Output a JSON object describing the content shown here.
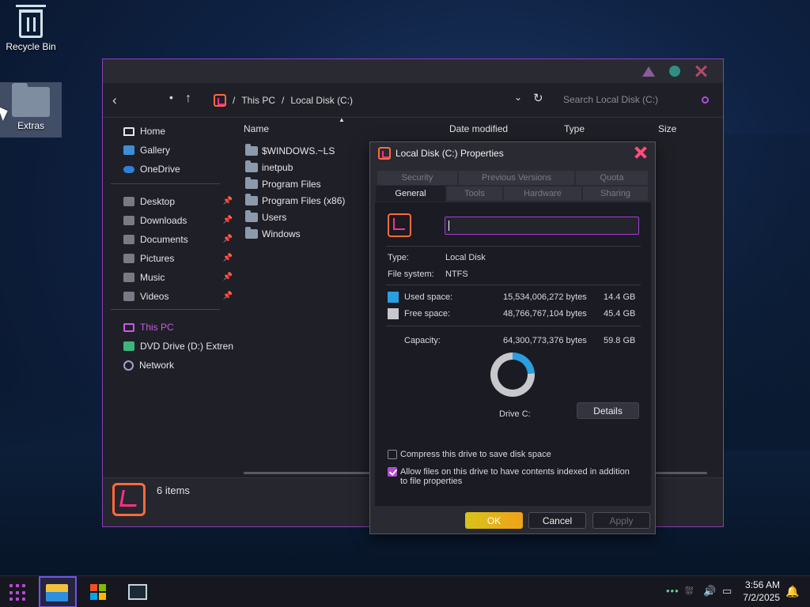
{
  "desktop": {
    "icons": [
      {
        "label": "Recycle Bin"
      },
      {
        "label": "Extras"
      }
    ]
  },
  "explorer": {
    "breadcrumb": [
      "This PC",
      "Local Disk (C:)"
    ],
    "breadcrumb_sep": "/",
    "search_placeholder": "Search Local Disk (C:)",
    "sidebar": {
      "quick": [
        {
          "label": "Home",
          "icon": "home-icon"
        },
        {
          "label": "Gallery",
          "icon": "gallery-icon"
        },
        {
          "label": "OneDrive",
          "icon": "cloud-icon"
        }
      ],
      "pinned": [
        {
          "label": "Desktop"
        },
        {
          "label": "Downloads"
        },
        {
          "label": "Documents"
        },
        {
          "label": "Pictures"
        },
        {
          "label": "Music"
        },
        {
          "label": "Videos"
        }
      ],
      "devices": [
        {
          "label": "This PC"
        },
        {
          "label": "DVD Drive (D:) Extren"
        },
        {
          "label": "Network"
        }
      ]
    },
    "columns": [
      "Name",
      "Date modified",
      "Type",
      "Size"
    ],
    "files": [
      "$WINDOWS.~LS",
      "inetpub",
      "Program Files",
      "Program Files (x86)",
      "Users",
      "Windows"
    ],
    "status": "6 items"
  },
  "dialog": {
    "title": "Local Disk (C:) Properties",
    "tabs_back": [
      "Security",
      "Previous Versions",
      "Quota"
    ],
    "tabs_front": [
      "General",
      "Tools",
      "Hardware",
      "Sharing"
    ],
    "name_value": "",
    "type_label": "Type:",
    "type_value": "Local Disk",
    "fs_label": "File system:",
    "fs_value": "NTFS",
    "used_label": "Used space:",
    "used_bytes": "15,534,006,272 bytes",
    "used_gb": "14.4 GB",
    "free_label": "Free space:",
    "free_bytes": "48,766,767,104 bytes",
    "free_gb": "45.4 GB",
    "cap_label": "Capacity:",
    "cap_bytes": "64,300,773,376 bytes",
    "cap_gb": "59.8 GB",
    "used_fraction": 0.2416,
    "drive_label": "Drive C:",
    "details_label": "Details",
    "compress_label": "Compress this drive to save disk space",
    "index_label": "Allow files on this drive to have contents indexed in addition to file properties",
    "ok_label": "OK",
    "cancel_label": "Cancel",
    "apply_label": "Apply",
    "colors": {
      "used": "#2a9ee0",
      "free": "#c8c8cc",
      "accent": "#b24ad0"
    }
  },
  "taskbar": {
    "time": "3:56 AM",
    "date": "7/2/2025"
  }
}
